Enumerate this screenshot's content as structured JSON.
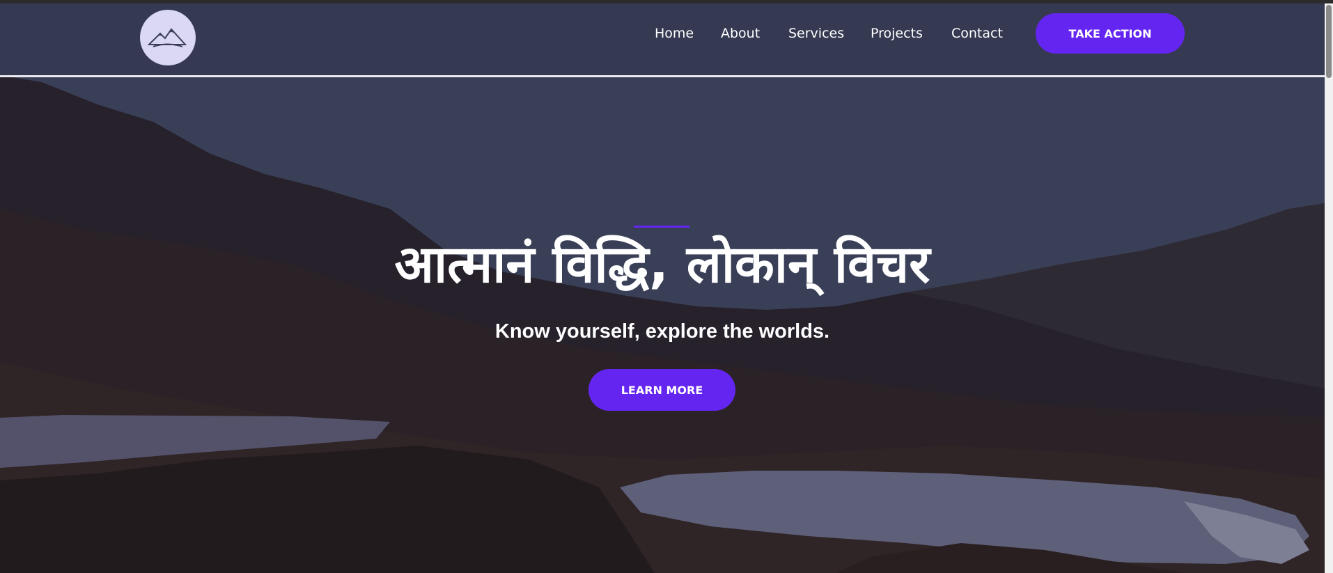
{
  "header": {
    "nav_items": [
      "Home",
      "About",
      "Services",
      "Projects",
      "Contact"
    ],
    "cta_label": "TAKE ACTION",
    "logo_icon": "mountain-icon"
  },
  "hero": {
    "title": "आत्मानं विद्धि, लोकान् विचर",
    "subtitle": "Know yourself, explore the worlds.",
    "button_label": "LEARN MORE"
  },
  "colors": {
    "accent": "#6525f0",
    "header_bg": "#353a52",
    "logo_bg": "#dad8f3"
  }
}
